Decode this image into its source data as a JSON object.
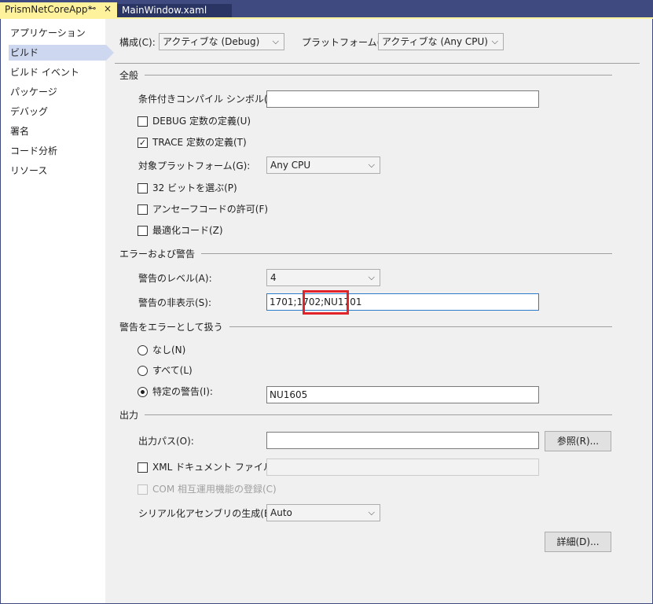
{
  "tabs": {
    "active": {
      "label": "PrismNetCoreApp*",
      "pin": "⊸",
      "close": "×"
    },
    "inactive": {
      "label": "MainWindow.xaml"
    }
  },
  "sidebar": {
    "items": [
      {
        "label": "アプリケーション"
      },
      {
        "label": "ビルド"
      },
      {
        "label": "ビルド イベント"
      },
      {
        "label": "パッケージ"
      },
      {
        "label": "デバッグ"
      },
      {
        "label": "署名"
      },
      {
        "label": "コード分析"
      },
      {
        "label": "リソース"
      }
    ]
  },
  "toolbar": {
    "config_label": "構成(C):",
    "config_value": "アクティブな (Debug)",
    "platform_label": "プラットフォーム(M):",
    "platform_value": "アクティブな (Any CPU)"
  },
  "general": {
    "title": "全般",
    "symbols_label": "条件付きコンパイル シンボル(Y):",
    "symbols_value": "",
    "debug_label": "DEBUG 定数の定義(U)",
    "debug_checked": false,
    "trace_label": "TRACE 定数の定義(T)",
    "trace_checked": true,
    "target_label": "対象プラットフォーム(G):",
    "target_value": "Any CPU",
    "prefer32_label": "32 ビットを選ぶ(P)",
    "unsafe_label": "アンセーフコードの許可(F)",
    "optimize_label": "最適化コード(Z)"
  },
  "errors": {
    "title": "エラーおよび警告",
    "level_label": "警告のレベル(A):",
    "level_value": "4",
    "suppress_label": "警告の非表示(S):",
    "suppress_value": "1701;1702;NU1701"
  },
  "treat": {
    "title": "警告をエラーとして扱う",
    "none_label": "なし(N)",
    "all_label": "すべて(L)",
    "specific_label": "特定の警告(I):",
    "specific_value": "NU1605",
    "selected": "specific"
  },
  "output": {
    "title": "出力",
    "path_label": "出力パス(O):",
    "path_value": "",
    "browse_label": "参照(R)...",
    "xml_label": "XML ドキュメント ファイル(X):",
    "xml_value": "",
    "com_label": "COM 相互運用機能の登録(C)",
    "serial_label": "シリアル化アセンブリの生成(E):",
    "serial_value": "Auto",
    "advanced_label": "詳細(D)..."
  },
  "icons": {
    "chevron": "⌵",
    "check": "✓"
  },
  "colors": {
    "active_tab": "#fff29d",
    "tab_strip": "#3f4a80",
    "selection": "#cdd8f0",
    "highlight": "#e0242a"
  }
}
